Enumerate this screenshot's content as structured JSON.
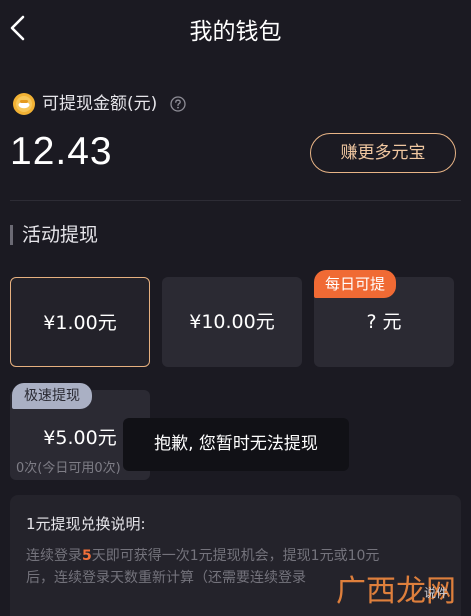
{
  "header": {
    "title": "我的钱包",
    "back_icon": "chevron-left-icon"
  },
  "balance": {
    "label": "可提现金额(元)",
    "amount": "12.43",
    "coin_icon": "coin-icon",
    "help_icon": "question-circle-icon",
    "earn_button": "赚更多元宝"
  },
  "activity": {
    "section_title": "活动提现",
    "options": [
      {
        "amount": "¥1.00元",
        "selected": true
      },
      {
        "amount": "¥10.00元",
        "selected": false
      },
      {
        "amount": "? 元",
        "selected": false,
        "badge": "每日可提"
      },
      {
        "amount": "¥5.00元",
        "selected": false,
        "badge": "极速提现",
        "usage": "0次(今日可用0次)"
      }
    ]
  },
  "toast": {
    "message": "抱歉, 您暂时无法提现"
  },
  "info": {
    "title": "1元提现兑换说明:",
    "line1_prefix": "连续登录",
    "line1_highlight": "5",
    "line1_suffix": "天即可获得一次1元提现机会，提现1元或10元",
    "line2": "后，连续登录天数重新计算（还需要连续登录"
  },
  "colors": {
    "background": "#1b1a22",
    "accent_gold": "#e6b07f",
    "badge_orange": "#f06a34",
    "highlight_orange": "#f2703a"
  },
  "watermark": {
    "text": "广西龙网",
    "small": "说件"
  }
}
